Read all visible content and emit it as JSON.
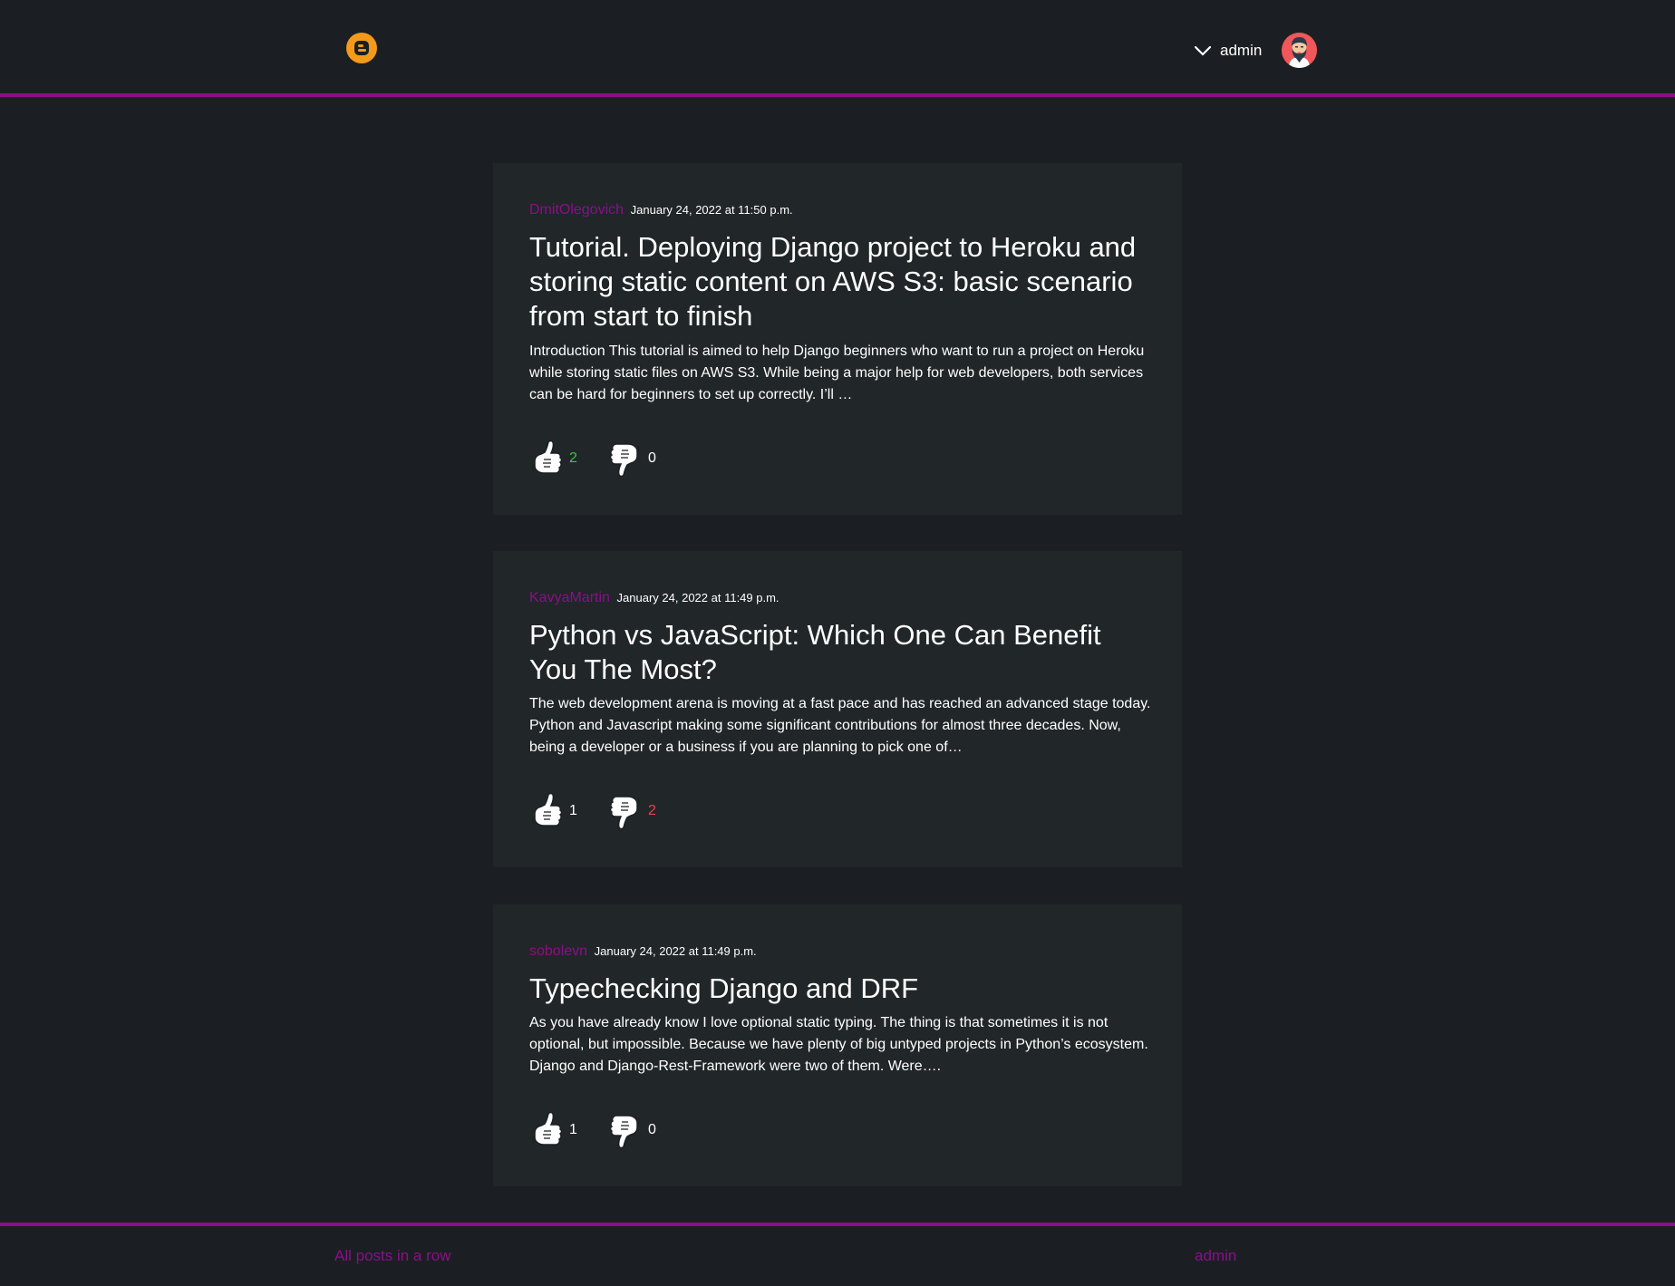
{
  "header": {
    "logo_icon": "blogger-b-icon",
    "user_menu_label": "admin",
    "chevron_icon": "chevron-down-icon",
    "avatar_icon": "bearded-man-avatar"
  },
  "colors": {
    "accent": "#8a0f8a",
    "logo": "#f39a1a",
    "like_positive": "#3fc43f",
    "dislike_positive": "#e04848"
  },
  "posts": [
    {
      "author": "DmitOlegovich",
      "date": "January 24, 2022 at 11:50 p.m.",
      "title": "Tutorial. Deploying Django project to Heroku and storing static content on AWS S3: basic scenario from start to finish",
      "excerpt": "Introduction This tutorial is aimed to help Django beginners who want to run a project on Heroku while storing static files on AWS S3. While being a major help for web developers, both services can be hard for beginners to set up correctly. I’ll …",
      "likes": "2",
      "dislikes": "0"
    },
    {
      "author": "KavyaMartin",
      "date": "January 24, 2022 at 11:49 p.m.",
      "title": "Python vs JavaScript: Which One Can Benefit You The Most?",
      "excerpt": "The web development arena is moving at a fast pace and has reached an advanced stage today. Python and Javascript making some significant contributions for almost three decades. Now, being a developer or a business if you are planning to pick one of…",
      "likes": "1",
      "dislikes": "2"
    },
    {
      "author": "sobolevn",
      "date": "January 24, 2022 at 11:49 p.m.",
      "title": "Typechecking Django and DRF",
      "excerpt": "As you have already know I love optional static typing. The thing is that sometimes it is not optional, but impossible. Because we have plenty of big untyped projects in Python’s ecosystem. Django and Django-Rest-Framework were two of them. Were….",
      "likes": "1",
      "dislikes": "0"
    }
  ],
  "footer": {
    "all_posts_link": "All posts in a row",
    "admin_link": "admin"
  }
}
